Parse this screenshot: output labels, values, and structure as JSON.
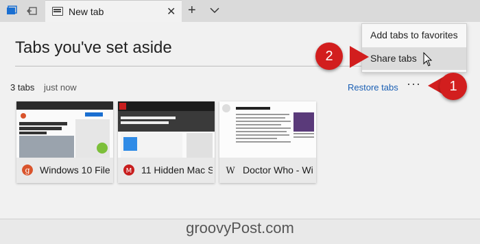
{
  "browser": {
    "active_tab_title": "New tab",
    "new_tab_symbol": "+",
    "close_symbol": "✕",
    "icons": [
      "tabs-set-aside-icon",
      "set-aside-tabs-icon",
      "new-tab-page-icon",
      "close-icon",
      "new-tab-icon",
      "chevron-down-icon"
    ]
  },
  "panel": {
    "title": "Tabs you've set aside",
    "count_label": "3 tabs",
    "time_label": "just now",
    "restore_label": "Restore tabs",
    "more_label": "···",
    "cards": [
      {
        "title": "Windows 10 File",
        "favicon_color": "#d9542c",
        "favicon_glyph": "g"
      },
      {
        "title": "11 Hidden Mac S",
        "favicon_color": "#c81e1e",
        "favicon_glyph": "M"
      },
      {
        "title": "Doctor Who - Wi",
        "favicon_color": "#ffffff",
        "favicon_glyph": "W"
      }
    ]
  },
  "menu": {
    "items": [
      {
        "label": "Add tabs to favorites"
      },
      {
        "label": "Share tabs"
      }
    ]
  },
  "callouts": {
    "one": "1",
    "two": "2"
  },
  "watermark": "groovyPost.com",
  "colors": {
    "accent": "#1a5fb4",
    "callout": "#d21e1e"
  }
}
